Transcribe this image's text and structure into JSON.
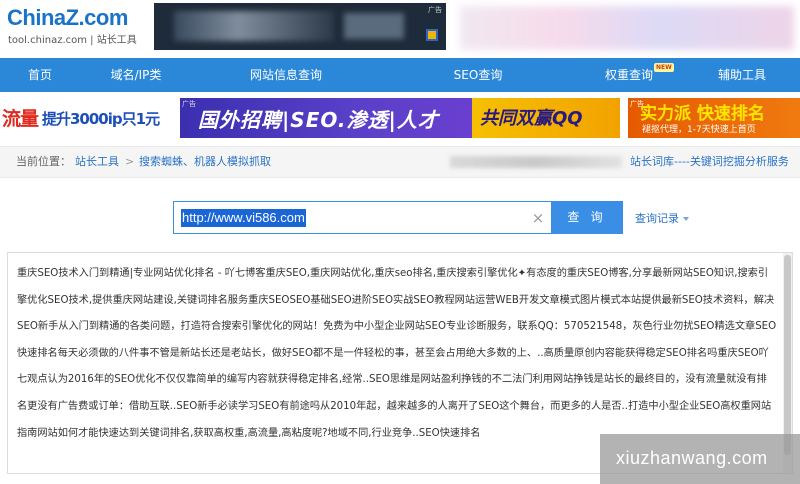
{
  "header": {
    "logo_text": "ChinaZ.com",
    "logo_sub": "tool.chinaz.com | 站长工具",
    "ad_tag": "广告"
  },
  "nav": [
    {
      "label": "首页"
    },
    {
      "label": "域名/IP类"
    },
    {
      "label": "网站信息查询"
    },
    {
      "label": "SEO查询"
    },
    {
      "label": "权重查询",
      "badge": "NEW"
    },
    {
      "label": "辅助工具"
    }
  ],
  "banners": {
    "left_big": "流量",
    "left_rest": "提升3000ip只1元",
    "mid": "国外招聘|SEO.渗透|人才",
    "mid_highlight": "共同双赢QQ",
    "right_main": "实力派 快速排名",
    "right_sub": "褪抠代理，1-7天快速上首页",
    "ad_tag": "广告"
  },
  "breadcrumb": {
    "label": "当前位置：",
    "home": "站长工具",
    "separator": ">",
    "current": "搜索蜘蛛、机器人模拟抓取",
    "right_link": "站长词库----关键词挖掘分析服务"
  },
  "search": {
    "value": "http://www.vi586.com",
    "clear_icon": "close-icon",
    "button": "查 询",
    "history": "查询记录"
  },
  "result": {
    "text": "重庆SEO技术入门到精通|专业网站优化排名 - 吖七博客重庆SEO,重庆网站优化,重庆seo排名,重庆搜索引擎优化✦有态度的重庆SEO博客,分享最新网站SEO知识,搜索引擎优化SEO技术,提供重庆网站建设,关键词排名服务重庆SEOSEO基础SEO进阶SEO实战SEO教程网站运营WEB开发文章模式图片模式本站提供最新SEO技术资料，解决SEO新手从入门到精通的各类问题，打造符合搜索引擎优化的网站！免费为中小型企业网站SEO专业诊断服务，联系QQ：570521548，灰色行业勿扰SEO精选文章SEO快速排名每天必须做的八件事不管是新站长还是老站长，做好SEO都不是一件轻松的事，甚至会占用绝大多数的上、..高质量原创内容能获得稳定SEO排名吗重庆SEO吖七观点认为2016年的SEO优化不仅仅靠简单的编写内容就获得稳定排名,经常..SEO思维是网站盈利挣钱的不二法门利用网站挣钱是站长的最终目的，没有流量就没有排名更没有广告费或订单：借助互联..SEO新手必读学习SEO有前途吗从2010年起，越来越多的人离开了SEO这个舞台，而更多的人是否..打造中小型企业SEO高权重网站指南网站如何才能快速达到关键词排名,获取高权重,高流量,高粘度呢?地域不同,行业竞争..SEO快速排名"
  },
  "watermark": "xiuzhanwang.com"
}
